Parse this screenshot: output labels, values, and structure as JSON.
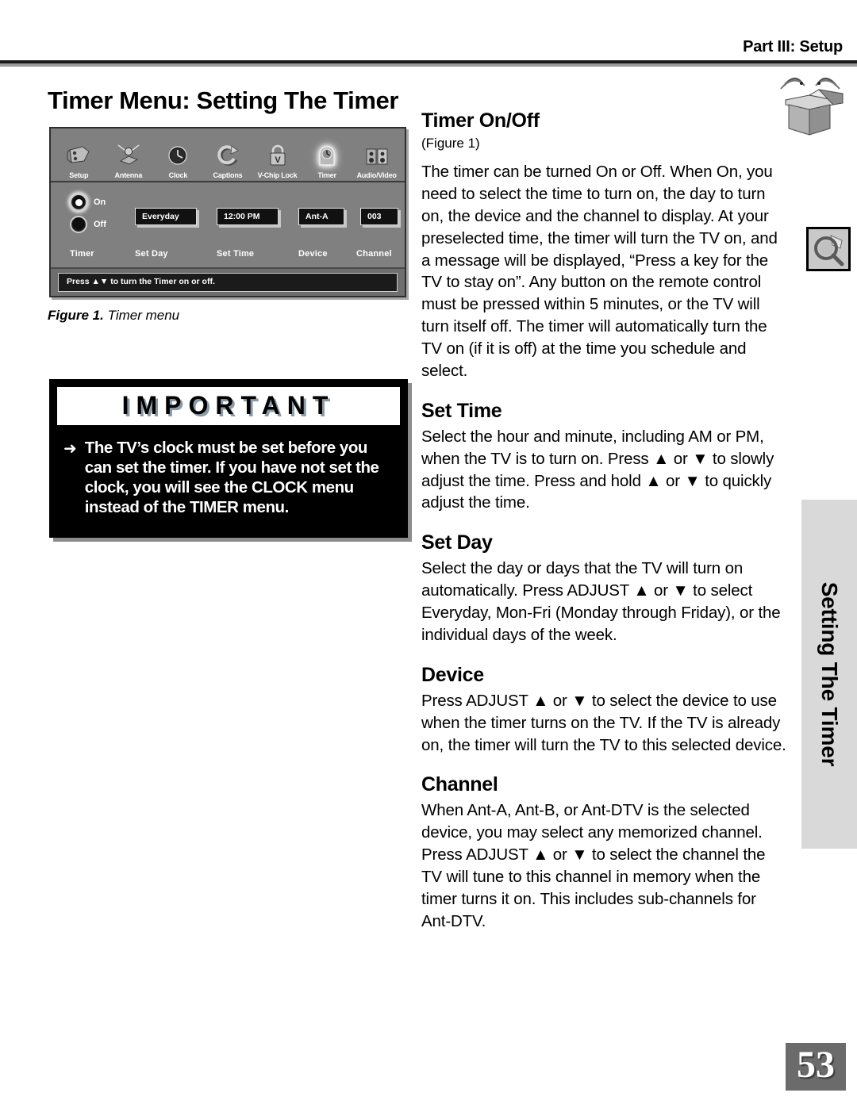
{
  "header": {
    "part_label": "Part III: Setup",
    "page_title": "Timer Menu: Setting The Timer"
  },
  "figure": {
    "caption_label": "Figure 1.",
    "caption_text": "Timer menu",
    "menu": {
      "icons": [
        {
          "label": "Setup",
          "icon": "tv-setup-icon",
          "selected": false
        },
        {
          "label": "Antenna",
          "icon": "antenna-icon",
          "selected": false
        },
        {
          "label": "Clock",
          "icon": "clock-icon",
          "selected": false
        },
        {
          "label": "Captions",
          "icon": "captions-icon",
          "selected": false
        },
        {
          "label": "V-Chip Lock",
          "icon": "padlock-icon",
          "selected": false
        },
        {
          "label": "Timer",
          "icon": "timer-icon",
          "selected": true
        },
        {
          "label": "Audio/Video",
          "icon": "audio-video-icon",
          "selected": false
        }
      ],
      "radio": {
        "caption": "Timer",
        "on_label": "On",
        "off_label": "Off",
        "selected": "On"
      },
      "fields": [
        {
          "caption": "Set Day",
          "value": "Everyday"
        },
        {
          "caption": "Set Time",
          "value": "12:00 PM"
        },
        {
          "caption": "Device",
          "value": "Ant-A"
        },
        {
          "caption": "Channel",
          "value": "003"
        }
      ],
      "status": "Press ▲▼ to turn the Timer on or off."
    }
  },
  "important": {
    "title": "IMPORTANT",
    "arrow": "➜",
    "text": "The TV’s clock must be set before you can set the timer.  If you have not set the clock, you will see the CLOCK menu instead of the TIMER menu."
  },
  "sections": [
    {
      "heading": "Timer On/Off",
      "subheading": "(Figure 1)",
      "body": "The timer can be turned On or Off.  When On, you need to select the time to turn on, the day to turn on, the device and the channel to display.  At your preselected time, the timer will turn the TV on, and a message will be displayed, “Press a key for the TV to stay on”.  Any button on the remote control must be pressed within 5 minutes, or the TV will turn itself off.  The timer will automatically turn the TV on (if it is off) at the time you schedule and select."
    },
    {
      "heading": "Set Time",
      "subheading": "",
      "body": "Select the hour and minute, including AM or PM, when the TV is to turn on.  Press ▲ or ▼ to slowly adjust the time.  Press and hold ▲ or ▼ to quickly adjust the time."
    },
    {
      "heading": "Set Day",
      "subheading": "",
      "body": "Select the day or days that the TV will turn on automatically.  Press ADJUST ▲ or ▼ to select Everyday, Mon-Fri (Monday through Friday), or the individual days of the week."
    },
    {
      "heading": "Device",
      "subheading": "",
      "body": "Press ADJUST ▲ or ▼ to select the device to use when the timer turns on the TV.  If the TV is already on, the timer will turn the TV to this selected device."
    },
    {
      "heading": "Channel",
      "subheading": "",
      "body": "When Ant-A, Ant-B, or Ant-DTV is the selected device, you may select any memorized channel.  Press ADJUST ▲ or ▼ to select the channel the TV will tune to this channel in memory when the timer turns it on.  This includes sub-channels for Ant-DTV."
    }
  ],
  "side_tab": {
    "text": "Setting The Timer"
  },
  "page_number": "53",
  "colors": {
    "menu_background": "#808080",
    "menu_field": "#111111",
    "side_tab": "#d9d9d9",
    "page_number_box": "#6b6b6b"
  }
}
